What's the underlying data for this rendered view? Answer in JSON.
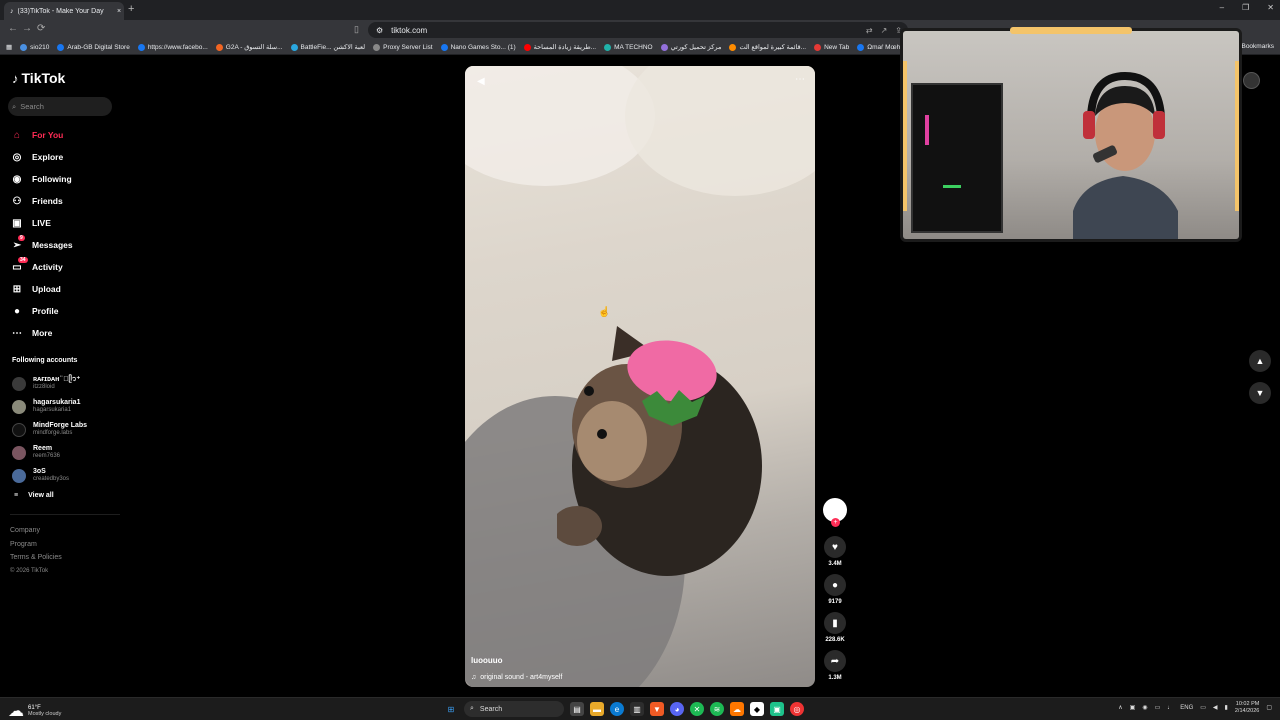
{
  "browser": {
    "tab_title": "(33)TikTok - Make Your Day",
    "tab_close": "×",
    "new_tab": "+",
    "url": "tiktok.com",
    "window_controls": [
      "–",
      "❐",
      "✕"
    ],
    "bookmarks": [
      {
        "label": "sio210",
        "color": "#4a90e2"
      },
      {
        "label": "Arab-GB Digital Store",
        "color": "#1877f2"
      },
      {
        "label": "https://www.facebo...",
        "color": "#1877f2"
      },
      {
        "label": "G2A - سلة التسوق...",
        "color": "#f26522"
      },
      {
        "label": "BattleFie... لعبة الاكشن",
        "color": "#2aa7e0"
      },
      {
        "label": "Proxy Server List",
        "color": "#888888"
      },
      {
        "label": "Nano Games Sto... (1)",
        "color": "#1877f2"
      },
      {
        "label": "طريقة زيادة المساحة...",
        "color": "#ff0000"
      },
      {
        "label": "MA TECHNO",
        "color": "#20b2aa"
      },
      {
        "label": "مركز تحميل كورتي",
        "color": "#9370db"
      },
      {
        "label": "قائمة كبيرة لمواقع الت...",
        "color": "#ff8c00"
      },
      {
        "label": "New Tab",
        "color": "#e53935"
      },
      {
        "label": "Ωmaŕ Mœhmmĕd",
        "color": "#1877f2"
      }
    ],
    "all_bookmarks": "All Bookmarks"
  },
  "tiktok": {
    "logo": "TikTok",
    "search_placeholder": "Search",
    "nav": [
      {
        "label": "For You",
        "icon": "home-icon",
        "active": true
      },
      {
        "label": "Explore",
        "icon": "compass-icon"
      },
      {
        "label": "Following",
        "icon": "following-icon"
      },
      {
        "label": "Friends",
        "icon": "friends-icon"
      },
      {
        "label": "LIVE",
        "icon": "live-icon"
      },
      {
        "label": "Messages",
        "icon": "messages-icon",
        "badge": "9"
      },
      {
        "label": "Activity",
        "icon": "activity-icon",
        "badge": "34"
      },
      {
        "label": "Upload",
        "icon": "upload-icon"
      },
      {
        "label": "Profile",
        "icon": "profile-icon"
      },
      {
        "label": "More",
        "icon": "more-icon"
      }
    ],
    "following_title": "Following accounts",
    "accounts": [
      {
        "name": "ʀᴀғɪᴅᴀʜ ̈ ⃝ᥫ᭡⁺",
        "user": "itzz8loid"
      },
      {
        "name": "hagarsukaria1",
        "user": "hagarsukaria1"
      },
      {
        "name": "MindForge Labs",
        "user": "mindforge.labs"
      },
      {
        "name": "Reem",
        "user": "reem7636"
      },
      {
        "name": "3oS",
        "user": "createdby3os"
      }
    ],
    "view_all": "View all",
    "footer": [
      "Company",
      "Program",
      "Terms & Policies"
    ],
    "copyright": "© 2026 TikTok"
  },
  "video": {
    "caption": "luoouuo",
    "sound": "original sound - art4myself",
    "likes": "3.4M",
    "comments": "9179",
    "saves": "228.6K",
    "shares": "1.3M"
  },
  "taskbar": {
    "temp": "61°F",
    "condition": "Mostly cloudy",
    "search": "Search",
    "lang": "ENG",
    "time": "10:02 PM",
    "date": "2/14/2026"
  }
}
